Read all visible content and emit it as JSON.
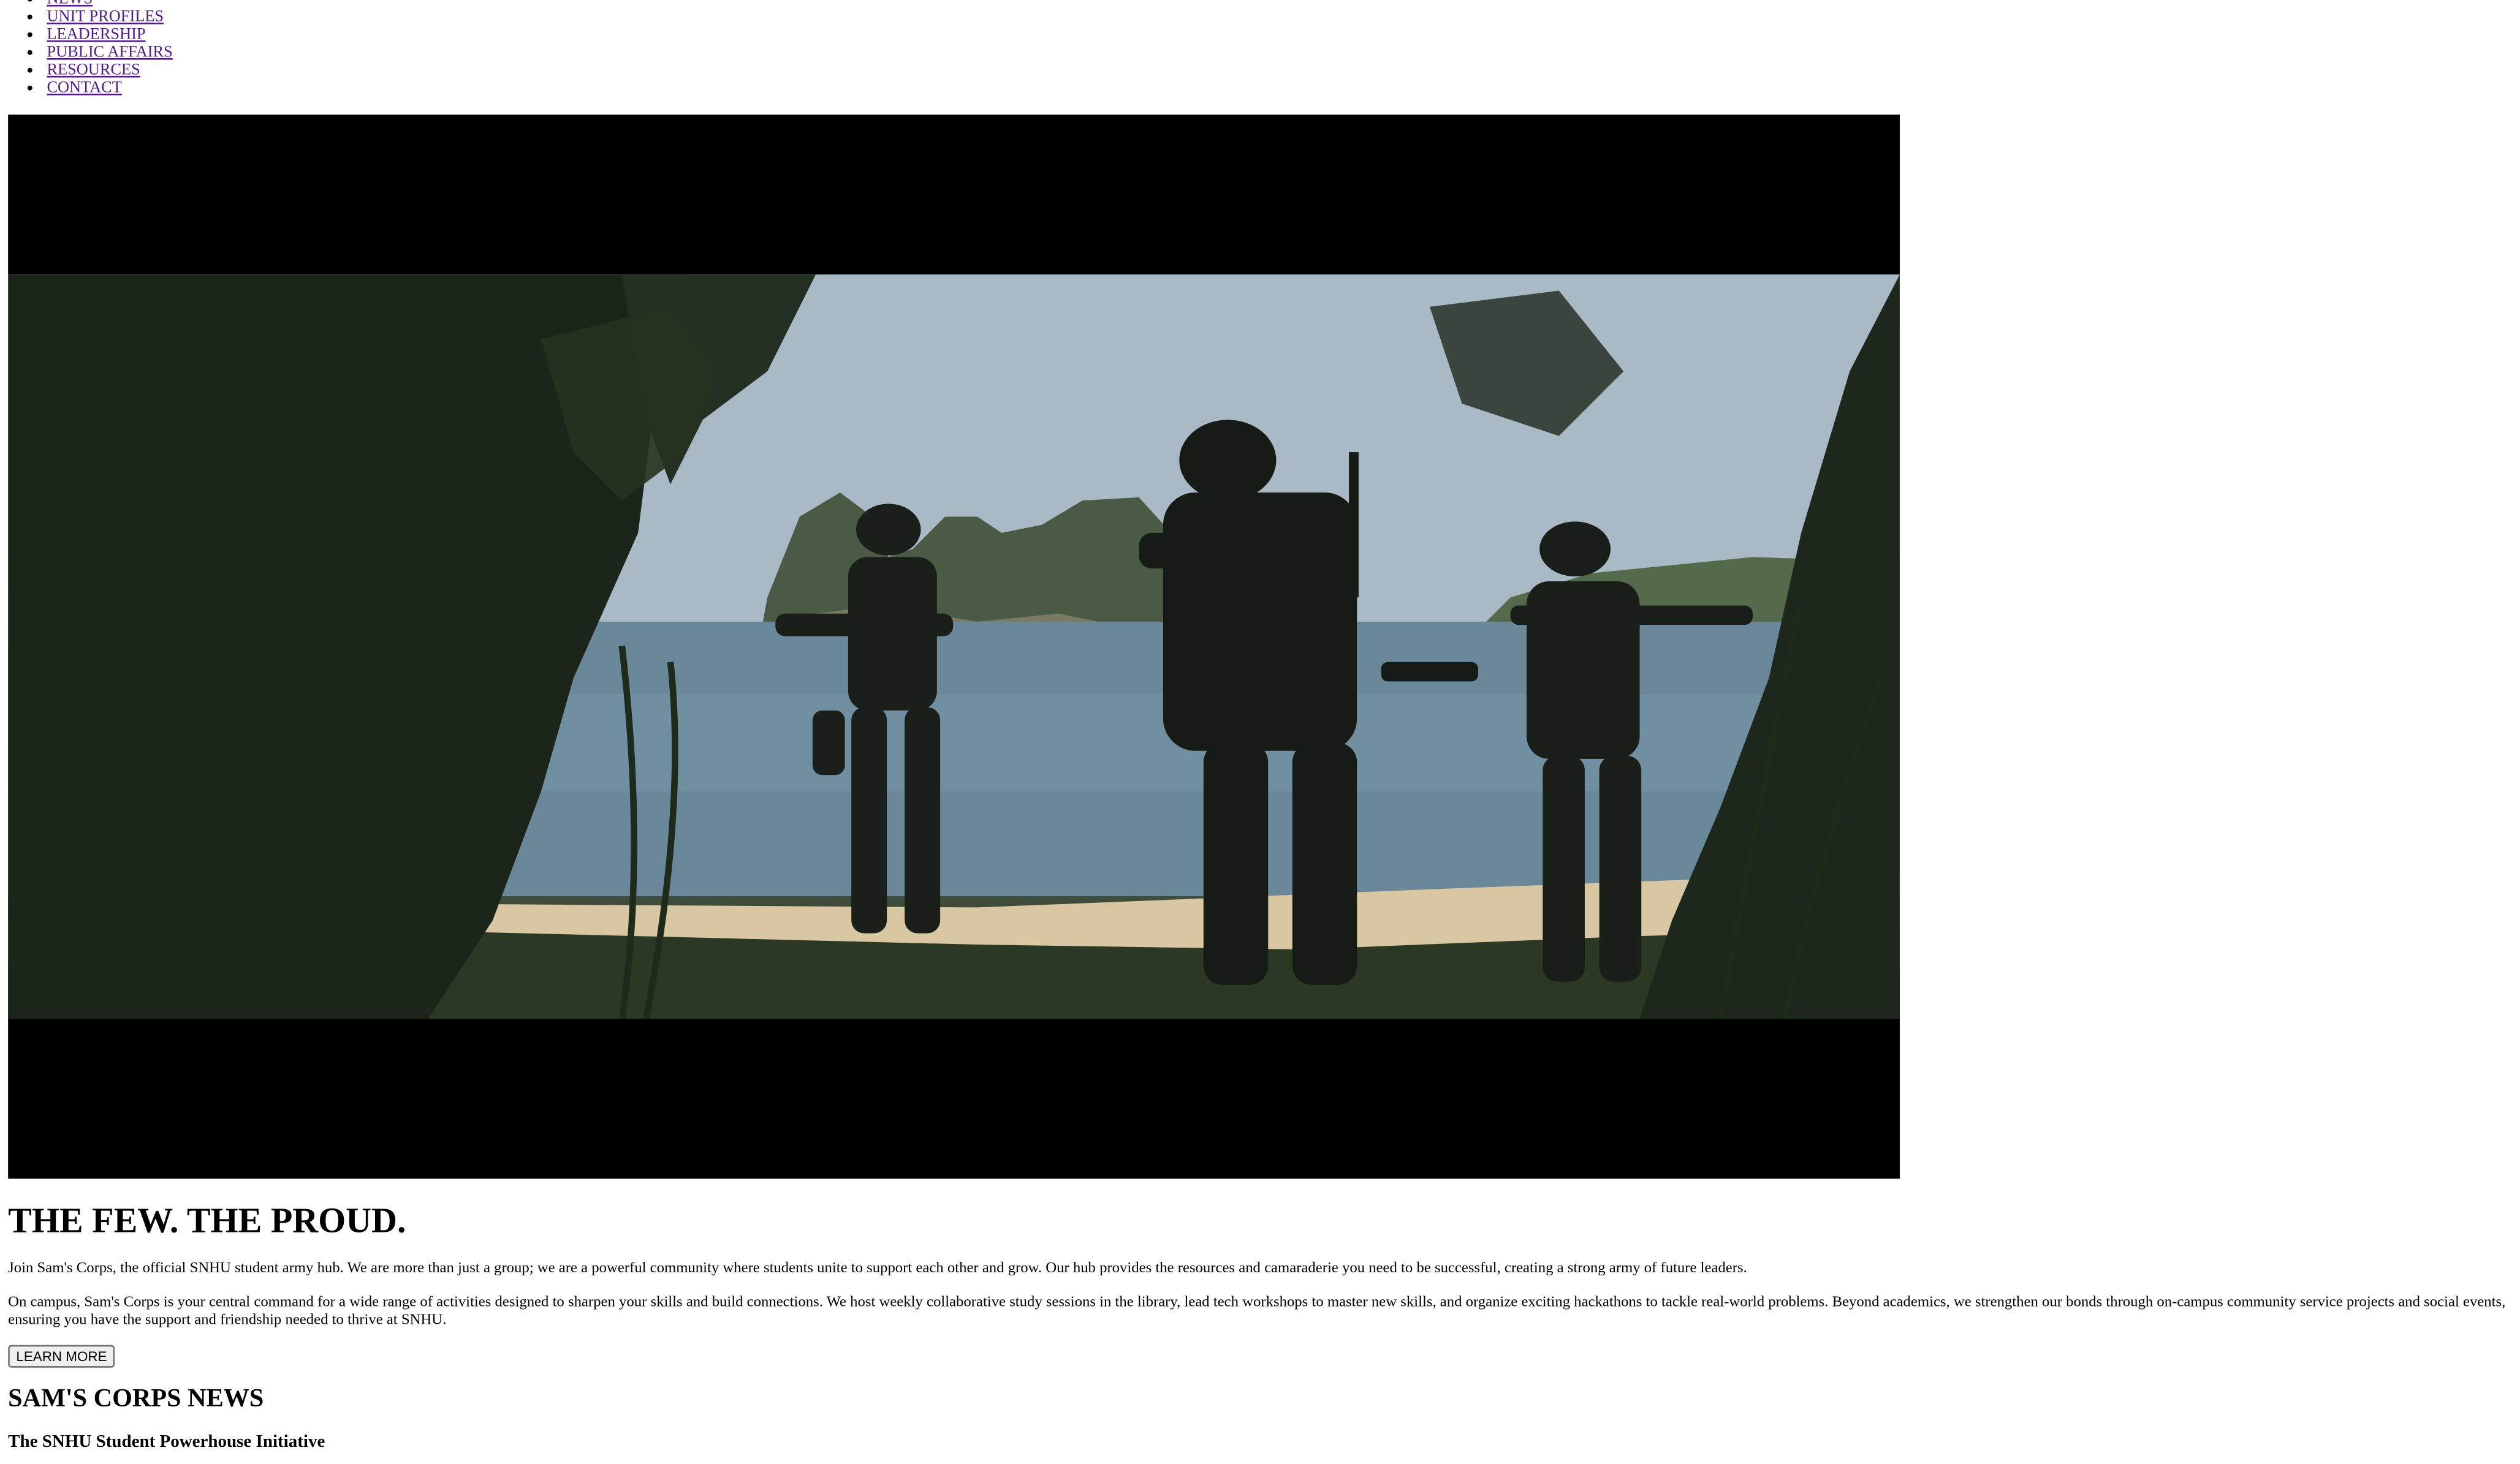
{
  "nav": {
    "items": [
      {
        "label": "NEWS"
      },
      {
        "label": "UNIT PROFILES"
      },
      {
        "label": "LEADERSHIP"
      },
      {
        "label": "PUBLIC AFFAIRS"
      },
      {
        "label": "RESOURCES"
      },
      {
        "label": "CONTACT"
      }
    ]
  },
  "hero": {
    "media": "video-frame"
  },
  "main": {
    "headline": "THE FEW. THE PROUD.",
    "paragraph_1": "Join Sam's Corps, the official SNHU student army hub. We are more than just a group; we are a powerful community where students unite to support each other and grow. Our hub provides the resources and camaraderie you need to be successful, creating a strong army of future leaders.",
    "paragraph_2": "On campus, Sam's Corps is your central command for a wide range of activities designed to sharpen your skills and build connections. We host weekly collaborative study sessions in the library, lead tech workshops to master new skills, and organize exciting hackathons to tackle real-world problems. Beyond academics, we strengthen our bonds through on-campus community service projects and social events, ensuring you have the support and friendship needed to thrive at SNHU.",
    "cta_label": "LEARN MORE"
  },
  "news": {
    "heading": "SAM'S CORPS NEWS",
    "items": [
      {
        "title": "The SNHU Student Powerhouse Initiative"
      }
    ]
  }
}
